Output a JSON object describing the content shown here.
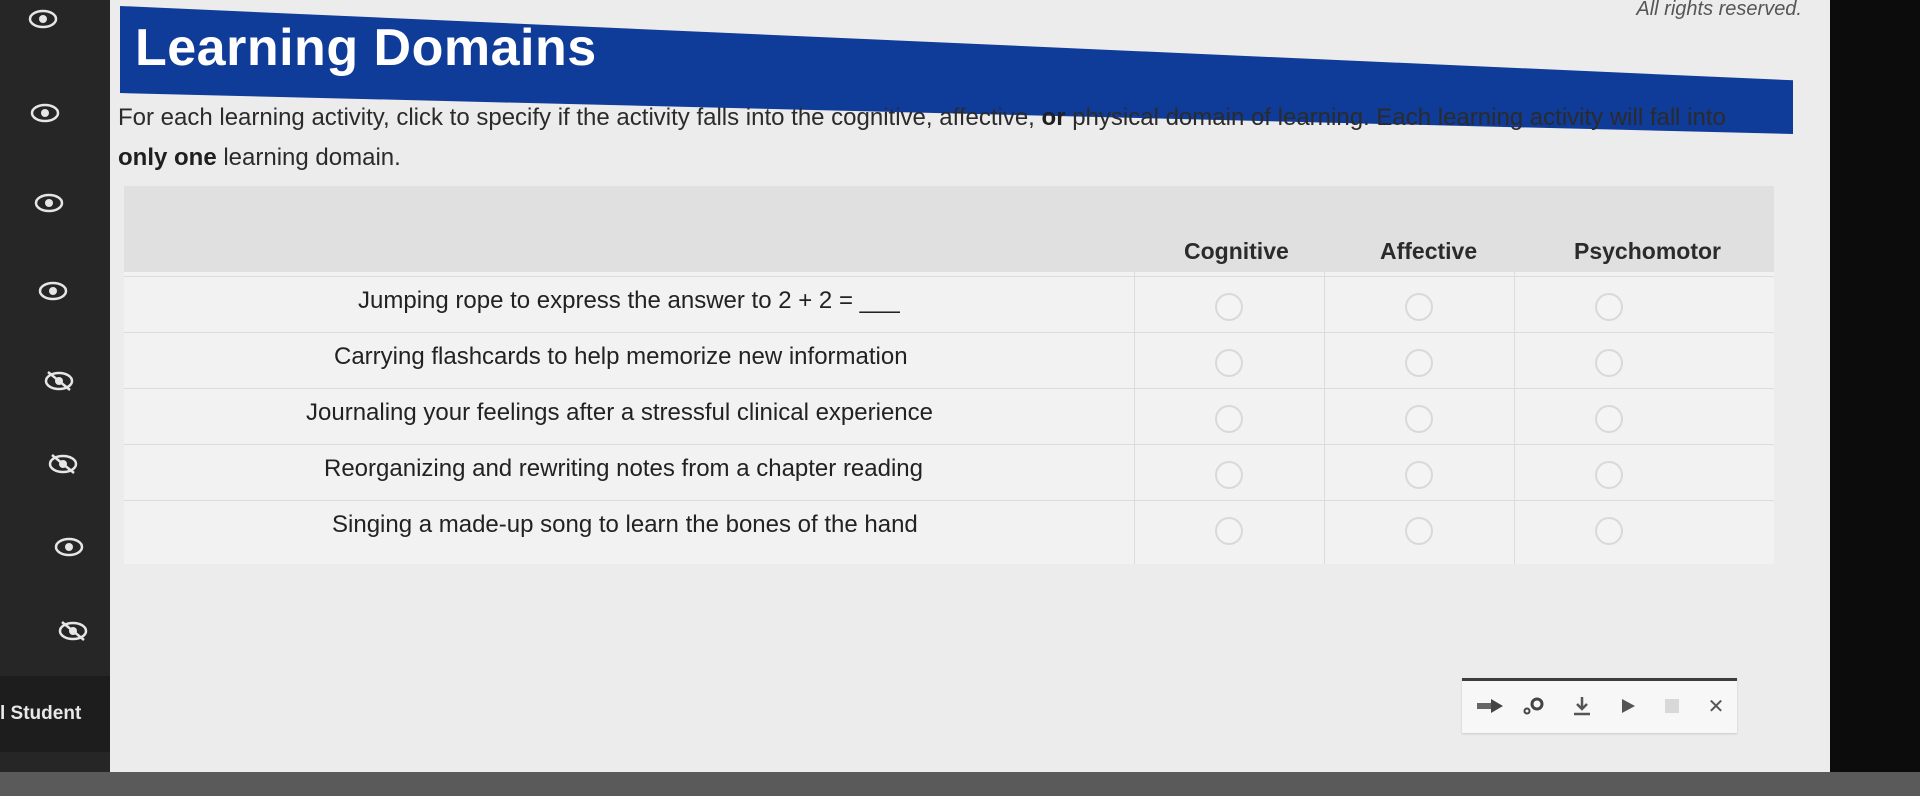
{
  "copyright": "All rights reserved.",
  "title": "Learning Domains",
  "instructions": {
    "part1": "For each learning activity, click to specify if the activity falls into the cognitive, affective, ",
    "or_word": "or",
    "part2": " physical domain of learning. Each learning activity will fall into ",
    "only_one": "only one",
    "part3": " learning domain."
  },
  "table": {
    "columns": [
      "Cognitive",
      "Affective",
      "Psychomotor"
    ],
    "rows": [
      {
        "label": "Jumping rope to express the answer to 2 + 2 = ___"
      },
      {
        "label": "Carrying flashcards to help memorize new information"
      },
      {
        "label": "Journaling your feelings after a stressful clinical experience"
      },
      {
        "label": "Reorganizing and rewriting notes from a chapter reading"
      },
      {
        "label": "Singing a made-up song to learn the bones of the hand"
      }
    ]
  },
  "sidebar": {
    "student_label": "l Student",
    "icons": [
      "eye-icon",
      "eye-icon",
      "eye-icon",
      "eye-icon",
      "eye-slash-icon",
      "eye-slash-icon",
      "eye-icon",
      "eye-slash-icon"
    ]
  },
  "toolbar": {
    "icons": [
      "arrow-right-icon",
      "settings-icon",
      "download-icon",
      "play-icon",
      "stop-icon",
      "close-icon"
    ],
    "close_glyph": "✕"
  },
  "colors": {
    "banner": "#0f3b99",
    "sidebar": "#262626",
    "panel": "#ececec"
  }
}
